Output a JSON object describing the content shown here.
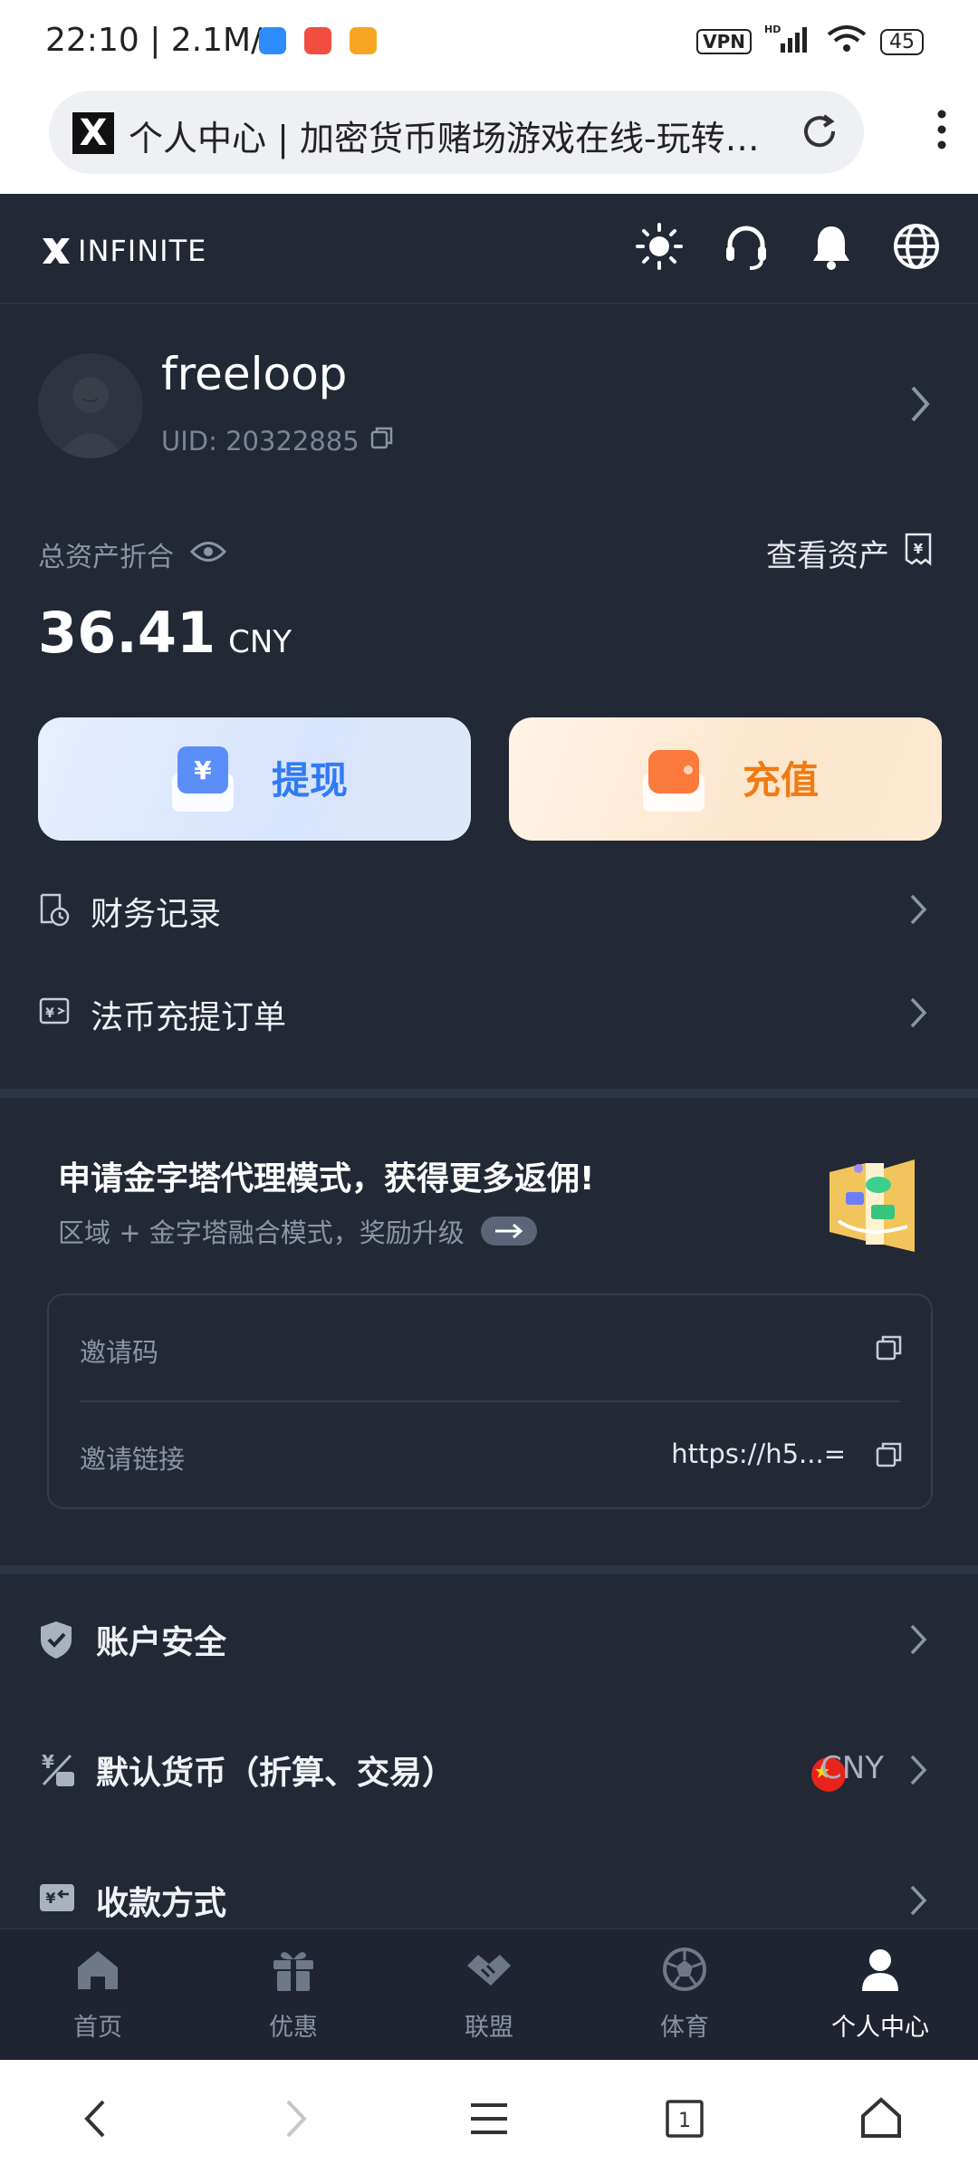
{
  "status_bar": {
    "time": "22:10",
    "speed": "2.1M/s",
    "vpn_label": "VPN",
    "hd_label": "HD",
    "battery": "45",
    "app_colors": [
      "#2f8cff",
      "#f04e3e",
      "#f7a623"
    ]
  },
  "browser": {
    "page_title": "个人中心 | 加密货币赌场游戏在线-玩转…",
    "favicon_letter": "X",
    "icons": [
      "reload-icon",
      "more-vert-icon"
    ]
  },
  "header": {
    "logo_text": "INFINITE",
    "icons": [
      "sun-icon",
      "headset-icon",
      "bell-icon",
      "globe-icon"
    ]
  },
  "profile": {
    "username": "freeloop",
    "uid": "UID: 20322885"
  },
  "assets": {
    "label": "总资产折合",
    "view_label": "查看资产",
    "amount": "36.41",
    "currency": "CNY"
  },
  "actions": {
    "withdraw_label": "提现",
    "deposit_label": "充值",
    "withdraw_color": "#2f7bf5",
    "deposit_color": "#f07b12"
  },
  "menu_rows": [
    {
      "label": "财务记录"
    },
    {
      "label": "法币充提订单"
    }
  ],
  "promo": {
    "title": "申请金字塔代理模式，获得更多返佣!",
    "subtitle": "区域 + 金字塔融合模式，奖励升级"
  },
  "invite": {
    "code_label": "邀请码",
    "code_value": "",
    "link_label": "邀请链接",
    "link_value": "https://h5...="
  },
  "settings": [
    {
      "label": "账户安全",
      "value": ""
    },
    {
      "label": "默认货币（折算、交易）",
      "value": "CNY"
    },
    {
      "label": "收款方式",
      "value": ""
    }
  ],
  "bottom_nav": [
    {
      "label": "首页",
      "icon": "home-icon"
    },
    {
      "label": "优惠",
      "icon": "gift-icon"
    },
    {
      "label": "联盟",
      "icon": "handshake-icon"
    },
    {
      "label": "体育",
      "icon": "soccer-ball-icon"
    },
    {
      "label": "个人中心",
      "icon": "person-icon",
      "active": true
    }
  ]
}
